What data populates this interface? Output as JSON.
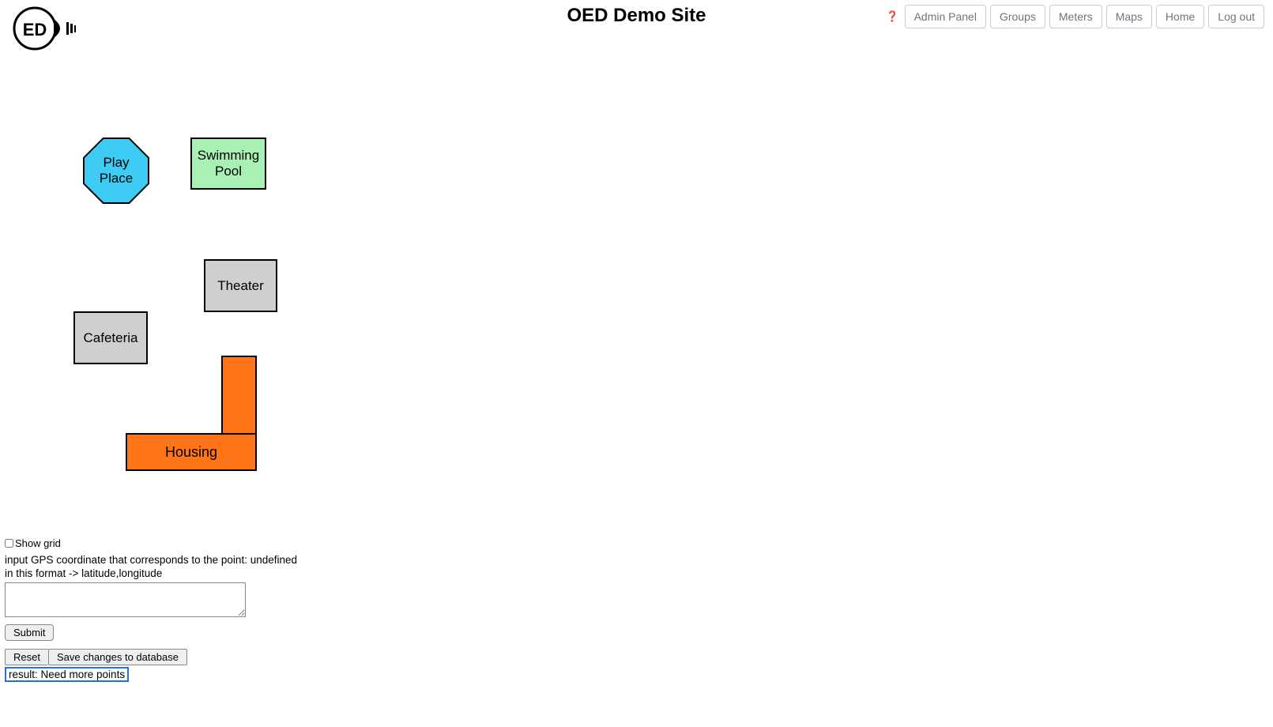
{
  "header": {
    "title": "OED Demo Site",
    "nav": {
      "admin_panel": "Admin Panel",
      "groups": "Groups",
      "meters": "Meters",
      "maps": "Maps",
      "home": "Home",
      "logout": "Log out"
    }
  },
  "map": {
    "buildings": {
      "play_place": "Play\nPlace",
      "swimming_pool": "Swimming\nPool",
      "theater": "Theater",
      "cafeteria": "Cafeteria",
      "housing": "Housing"
    }
  },
  "controls": {
    "show_grid_label": "Show grid",
    "instruction_line1": "input GPS coordinate that corresponds to the point: undefined",
    "instruction_line2": "in this format -> latitude,longitude",
    "submit_label": "Submit",
    "reset_label": "Reset",
    "save_label": "Save changes to database",
    "result_text": "result: Need more points"
  }
}
